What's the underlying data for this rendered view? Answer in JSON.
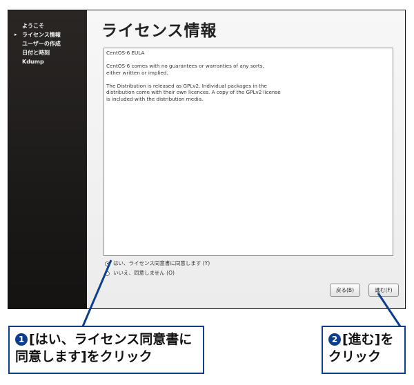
{
  "sidebar": {
    "items": [
      {
        "label": "ようこそ",
        "current": false
      },
      {
        "label": "ライセンス情報",
        "current": true
      },
      {
        "label": "ユーザーの作成",
        "current": false
      },
      {
        "label": "日付と時刻",
        "current": false
      },
      {
        "label": "Kdump",
        "current": false
      }
    ],
    "current_marker": "▸"
  },
  "main": {
    "title": "ライセンス情報",
    "license_paragraphs": [
      "CentOS-6 EULA",
      "CentOS-6 comes with no guarantees or warranties of any sorts,\neither written or implied.",
      "The Distribution is released as GPLv2. Individual packages in the\ndistribution come with their own licences. A copy of the GPLv2 license\nis included with the distribution media."
    ],
    "radio_agree": {
      "label": "はい、ライセンス同意書に同意します (Y)",
      "checked": true
    },
    "radio_disagree": {
      "label": "いいえ、同意しません (O)",
      "checked": false
    },
    "back_button": "戻る(B)",
    "forward_button": "進む(F)"
  },
  "callouts": {
    "one": {
      "number": "1",
      "line1": "[はい、ライセンス同意書に",
      "line2": "同意します]をクリック"
    },
    "two": {
      "number": "2",
      "line1": "[進む]を",
      "line2": "クリック"
    }
  },
  "colors": {
    "callout_border": "#0b3e8f",
    "sidebar_bg": "#1e1e1e"
  }
}
